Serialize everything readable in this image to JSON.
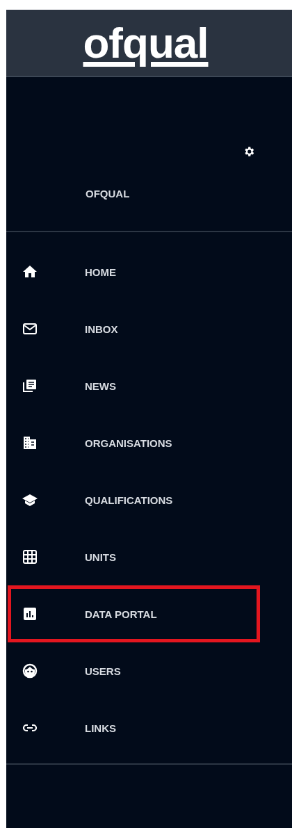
{
  "logo": "ofqual",
  "account": {
    "name": "OFQUAL"
  },
  "nav": [
    {
      "kind": "home",
      "label": "HOME",
      "highlighted": false
    },
    {
      "kind": "inbox",
      "label": "INBOX",
      "highlighted": false
    },
    {
      "kind": "news",
      "label": "NEWS",
      "highlighted": false
    },
    {
      "kind": "organisations",
      "label": "ORGANISATIONS",
      "highlighted": false
    },
    {
      "kind": "qualifications",
      "label": "QUALIFICATIONS",
      "highlighted": false
    },
    {
      "kind": "units",
      "label": "UNITS",
      "highlighted": false
    },
    {
      "kind": "data",
      "label": "DATA PORTAL",
      "highlighted": true
    },
    {
      "kind": "users",
      "label": "USERS",
      "highlighted": false
    },
    {
      "kind": "links",
      "label": "LINKS",
      "highlighted": false
    }
  ]
}
